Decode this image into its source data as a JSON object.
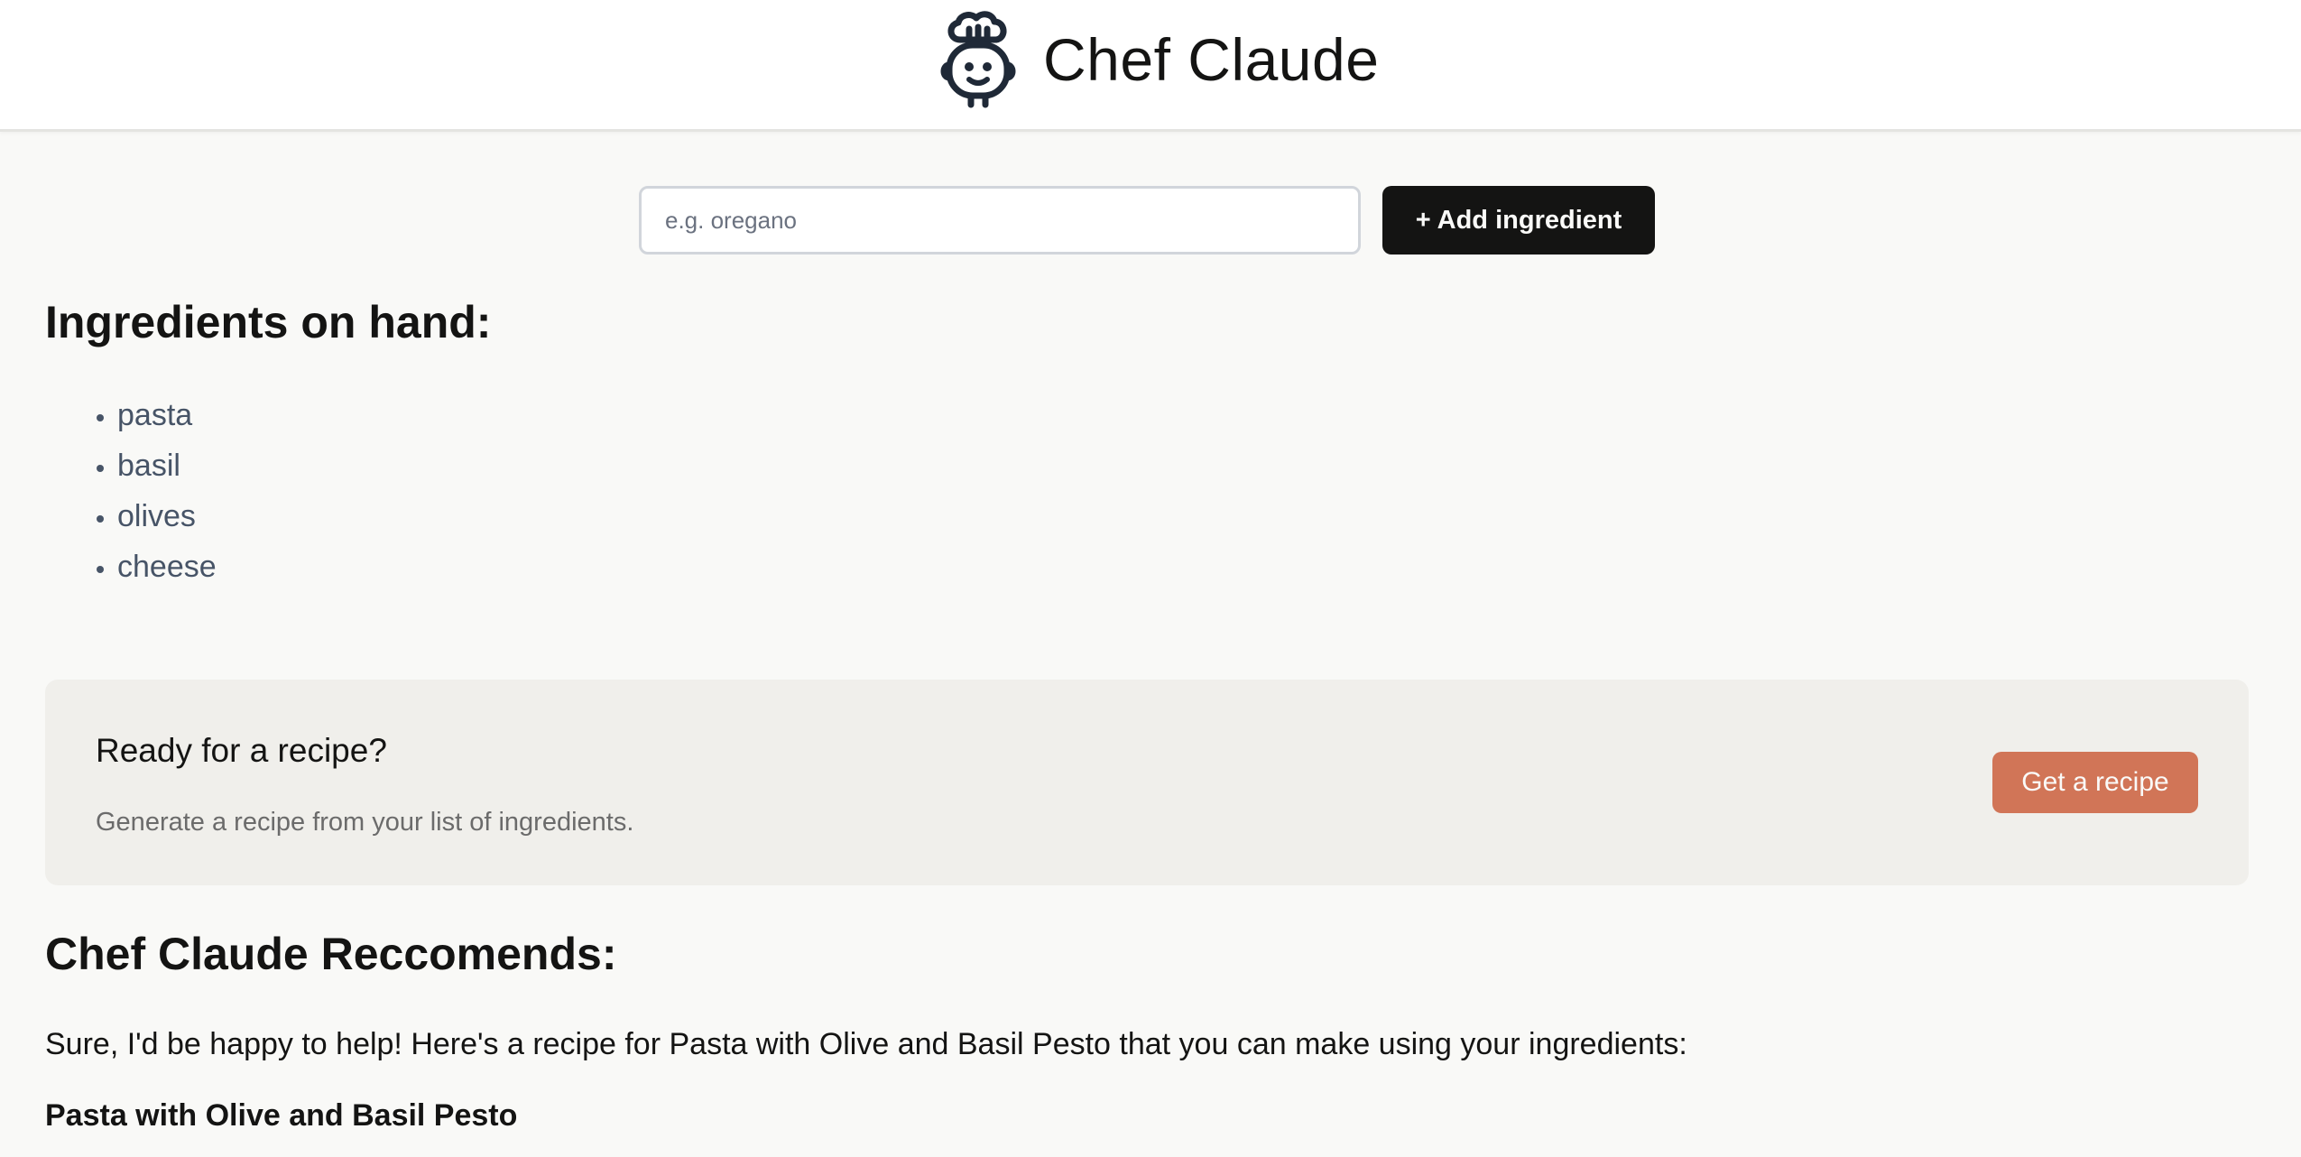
{
  "app": {
    "title": "Chef Claude",
    "logo_icon": "chef-robot-icon"
  },
  "ingredient_form": {
    "input_value": "",
    "input_placeholder": "e.g. oregano",
    "add_button_label": "+ Add ingredient"
  },
  "ingredients": {
    "heading": "Ingredients on hand:",
    "items": [
      "pasta",
      "basil",
      "olives",
      "cheese"
    ]
  },
  "recipe_card": {
    "title": "Ready for a recipe?",
    "subtitle": "Generate a recipe from your list of ingredients.",
    "button_label": "Get a recipe"
  },
  "recommendation": {
    "heading": "Chef Claude Reccomends:",
    "intro": "Sure, I'd be happy to help! Here's a recipe for Pasta with Olive and Basil Pesto that you can make using your ingredients:",
    "recipe_name": "Pasta with Olive and Basil Pesto"
  },
  "colors": {
    "page_background": "#f9f9f7",
    "primary_button": "#141413",
    "accent_button": "#d17557",
    "card_background": "#f0efeb",
    "list_text": "#475467"
  }
}
